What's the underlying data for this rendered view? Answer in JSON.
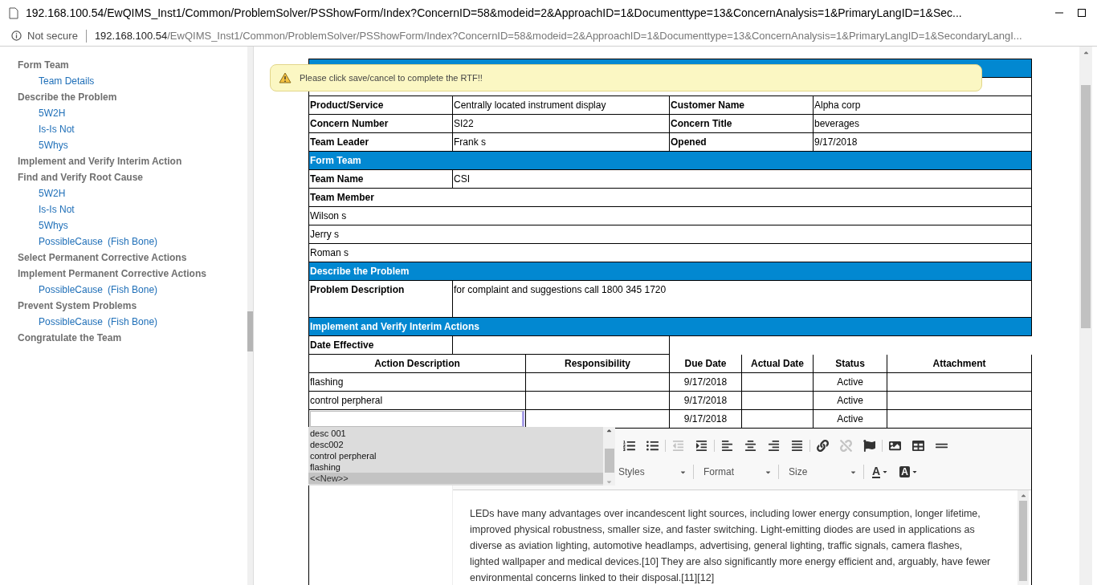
{
  "browser": {
    "title": "192.168.100.54/EwQIMS_Inst1/Common/ProblemSolver/PSShowForm/Index?ConcernID=58&modeid=2&ApproachID=1&Documenttype=13&ConcernAnalysis=1&PrimaryLangID=1&Sec...",
    "security": "Not secure",
    "url_host": "192.168.100.54",
    "url_path": "/EwQIMS_Inst1/Common/ProblemSolver/PSShowForm/Index?ConcernID=58&modeid=2&ApproachID=1&Documenttype=13&ConcernAnalysis=1&PrimaryLangID=1&SecondaryLangI..."
  },
  "sidebar": {
    "sections": [
      {
        "label": "Form Team",
        "children": [
          {
            "label": "Team Details"
          }
        ]
      },
      {
        "label": "Describe the Problem",
        "children": [
          {
            "label": "5W2H"
          },
          {
            "label": "Is-Is Not"
          },
          {
            "label": "5Whys"
          }
        ]
      },
      {
        "label": "Implement and Verify Interim Action"
      },
      {
        "label": "Find and Verify Root Cause",
        "children": [
          {
            "label": "5W2H"
          },
          {
            "label": "Is-Is Not"
          },
          {
            "label": "5Whys"
          },
          {
            "label": "PossibleCause",
            "note": "(Fish Bone)"
          }
        ]
      },
      {
        "label": "Select Permanent Corrective Actions"
      },
      {
        "label": "Implement Permanent Corrective Actions",
        "children": [
          {
            "label": "PossibleCause",
            "note": "(Fish Bone)"
          }
        ]
      },
      {
        "label": "Prevent System Problems",
        "children": [
          {
            "label": "PossibleCause",
            "note": "(Fish Bone)"
          }
        ]
      },
      {
        "label": "Congratulate the Team"
      }
    ]
  },
  "notification": {
    "kind": "warning",
    "text": "Please click save/cancel to complete the RTF!!"
  },
  "details": [
    [
      {
        "label": "Product/Service",
        "value": "Centrally located instrument display"
      },
      {
        "label": "Customer Name",
        "value": "Alpha corp"
      }
    ],
    [
      {
        "label": "Concern Number",
        "value": "SI22"
      },
      {
        "label": "Concern Title",
        "value": "beverages"
      }
    ],
    [
      {
        "label": "Team Leader",
        "value": "Frank s"
      },
      {
        "label": "Opened",
        "value": "9/17/2018"
      }
    ]
  ],
  "form_team": {
    "heading": "Form Team",
    "name_label": "Team Name",
    "name": "CSI",
    "member_label": "Team Member",
    "members": [
      "Wilson s",
      "Jerry s",
      "Roman s"
    ]
  },
  "problem": {
    "heading": "Describe the Problem",
    "label": "Problem Description",
    "value": "for complaint and suggestions call 1800 345 1720"
  },
  "interim": {
    "heading": "Implement and Verify Interim Actions",
    "date_label": "Date Effective",
    "columns": [
      "Action Description",
      "Responsibility",
      "Due Date",
      "Actual Date",
      "Status",
      "Attachment"
    ],
    "rows": [
      {
        "description": "flashing",
        "due_date": "9/17/2018",
        "status": "Active",
        "editing": false
      },
      {
        "description": "control perpheral",
        "due_date": "9/17/2018",
        "status": "Active",
        "editing": false
      },
      {
        "due_date": "9/17/2018",
        "status": "Active",
        "editing": true
      }
    ]
  },
  "autocomplete": {
    "options": [
      {
        "label": "desc 001",
        "selected": false
      },
      {
        "label": "desc002",
        "selected": false
      },
      {
        "label": "control perpheral",
        "selected": false
      },
      {
        "label": "flashing",
        "selected": false
      },
      {
        "label": "<<New>>",
        "selected": true
      }
    ]
  },
  "editor": {
    "toolbar_groups": [
      [
        {
          "kind": "numbered-list",
          "disabled": false
        },
        {
          "kind": "bulleted-list",
          "disabled": false
        }
      ],
      [
        {
          "kind": "outdent",
          "disabled": true
        },
        {
          "kind": "indent",
          "disabled": false
        }
      ],
      [
        {
          "kind": "align-left",
          "disabled": false
        },
        {
          "kind": "align-center",
          "disabled": false
        },
        {
          "kind": "align-right",
          "disabled": false
        },
        {
          "kind": "justify",
          "disabled": false
        }
      ],
      [
        {
          "kind": "link",
          "disabled": false
        },
        {
          "kind": "unlink",
          "disabled": true
        },
        {
          "kind": "anchor",
          "disabled": false
        }
      ],
      [
        {
          "kind": "image",
          "disabled": false
        },
        {
          "kind": "table",
          "disabled": false
        },
        {
          "kind": "horizontal-line",
          "disabled": false
        }
      ]
    ],
    "format_controls": [
      {
        "kind": "dropdown",
        "label": "Styles"
      },
      {
        "kind": "dropdown",
        "label": "Format"
      },
      {
        "kind": "dropdown",
        "label": "Size"
      },
      {
        "kind": "text-color",
        "label": "A"
      },
      {
        "kind": "background-color",
        "label": "A"
      }
    ],
    "content": "LEDs have many advantages over incandescent light sources, including lower energy consumption, longer lifetime, improved physical robustness, smaller size, and faster switching. Light-emitting diodes are used in applications as diverse as aviation lighting, automotive headlamps, advertising, general lighting, traffic signals, camera flashes, lighted wallpaper and medical devices.[10] They are also significantly more energy efficient and, arguably, have fewer environmental concerns linked to their disposal.[11][12]"
  }
}
